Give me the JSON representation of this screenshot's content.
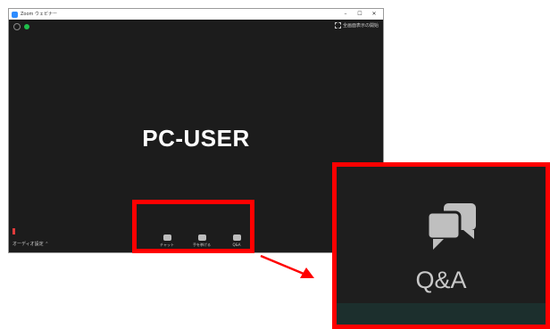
{
  "window": {
    "title": "Zoom ウェビナー",
    "controls": [
      "–",
      "☐",
      "✕"
    ],
    "fullscreen_label": "全画面表示の開始"
  },
  "participant": {
    "name": "PC-USER"
  },
  "audio": {
    "settings_label": "オーディオ設定 ⌃"
  },
  "toolbar": {
    "items": [
      {
        "label": "チャット",
        "icon": "chat-icon"
      },
      {
        "label": "手を挙げる",
        "icon": "raise-hand-icon"
      },
      {
        "label": "Q&A",
        "icon": "qa-icon"
      }
    ]
  },
  "inset": {
    "label": "Q&A",
    "icon": "qa-icon"
  },
  "colors": {
    "highlight": "#ff0000",
    "accent": "#2d8cff",
    "status": "#1fbf4b"
  }
}
